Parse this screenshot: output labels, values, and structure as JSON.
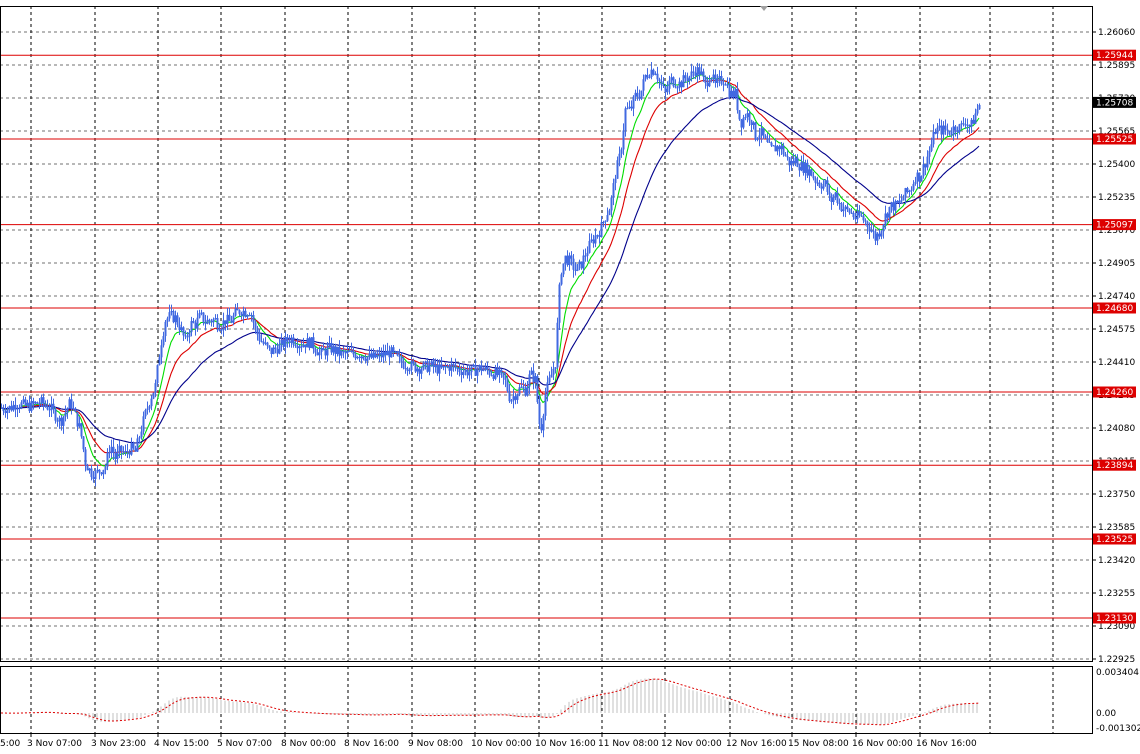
{
  "chart_data": {
    "type": "candlestick",
    "instrument_hint": "",
    "price_axis": {
      "range": [
        1.22925,
        1.2612
      ],
      "ticks": [
        "1.26060",
        "1.25895",
        "1.25730",
        "1.25565",
        "1.25400",
        "1.25235",
        "1.25070",
        "1.24905",
        "1.24740",
        "1.24575",
        "1.24410",
        "1.24245",
        "1.24080",
        "1.23915",
        "1.23750",
        "1.23585",
        "1.23420",
        "1.23255",
        "1.23090",
        "1.22925"
      ]
    },
    "time_axis": {
      "labels": [
        "3 Nov 07:00",
        "3 Nov 23:00",
        "4 Nov 15:00",
        "5 Nov 07:00",
        "8 Nov 00:00",
        "8 Nov 16:00",
        "9 Nov 08:00",
        "10 Nov 00:00",
        "10 Nov 16:00",
        "11 Nov 08:00",
        "12 Nov 00:00",
        "12 Nov 16:00",
        "15 Nov 08:00",
        "16 Nov 00:00",
        "16 Nov 16:00"
      ],
      "left_partial_label": "5:00"
    },
    "current_price": "1.25708",
    "levels": [
      {
        "label": "1.25944",
        "value": 1.25944
      },
      {
        "label": "1.25525",
        "value": 1.25525
      },
      {
        "label": "1.25097",
        "value": 1.25097
      },
      {
        "label": "1.24680",
        "value": 1.2468
      },
      {
        "label": "1.24260",
        "value": 1.2426
      },
      {
        "label": "1.23894",
        "value": 1.23894
      },
      {
        "label": "1.23525",
        "value": 1.23525
      },
      {
        "label": "1.23130",
        "value": 1.2313
      }
    ],
    "price_path": {
      "x": [
        0,
        5,
        10,
        15,
        20,
        25,
        30,
        40,
        50,
        60,
        65,
        70,
        75,
        80,
        85,
        90,
        95,
        100,
        105,
        110,
        115,
        120,
        125,
        130,
        135,
        140,
        145,
        150,
        155,
        160,
        165,
        170,
        175,
        180,
        185,
        190,
        195,
        200,
        205,
        210,
        215,
        220,
        225,
        230,
        235,
        240,
        245,
        250,
        255,
        260,
        270,
        280,
        290,
        300,
        310,
        320,
        330,
        340,
        350,
        360,
        370,
        380,
        390,
        400,
        410,
        420,
        430,
        440,
        450,
        460,
        470,
        480,
        490,
        500,
        505,
        510,
        515,
        520,
        525,
        530,
        535,
        540,
        545,
        550,
        555,
        560,
        565,
        570,
        575,
        580,
        585,
        590,
        595,
        600,
        605,
        610,
        615,
        620,
        625,
        630,
        635,
        640,
        645,
        650,
        655,
        660,
        665,
        670,
        675,
        680,
        685,
        690,
        695,
        700,
        705,
        710,
        715,
        720,
        725,
        730,
        735,
        740,
        745,
        750,
        755,
        760,
        765,
        770,
        775,
        780,
        785,
        790,
        795,
        800,
        805,
        810,
        815,
        820,
        825,
        830,
        835,
        840,
        845,
        850,
        855,
        860,
        865,
        870,
        875,
        880,
        885,
        890,
        895,
        900,
        905,
        910,
        915,
        920,
        925,
        930,
        935,
        940,
        945,
        950,
        955,
        960,
        965,
        970,
        975,
        980
      ],
      "y": [
        1.2418,
        1.2418,
        1.2418,
        1.242,
        1.242,
        1.2419,
        1.2419,
        1.2421,
        1.2418,
        1.2411,
        1.2416,
        1.2421,
        1.2414,
        1.2407,
        1.2391,
        1.2386,
        1.2385,
        1.2387,
        1.2389,
        1.24,
        1.2393,
        1.2397,
        1.2395,
        1.2398,
        1.2396,
        1.2406,
        1.2415,
        1.2423,
        1.2429,
        1.2449,
        1.2462,
        1.2464,
        1.2463,
        1.2458,
        1.2451,
        1.246,
        1.246,
        1.2464,
        1.2461,
        1.2462,
        1.2462,
        1.2459,
        1.2462,
        1.2461,
        1.2465,
        1.2467,
        1.2466,
        1.2467,
        1.2457,
        1.2452,
        1.2446,
        1.2449,
        1.2453,
        1.245,
        1.2451,
        1.2445,
        1.2448,
        1.2445,
        1.2445,
        1.2445,
        1.2443,
        1.2444,
        1.2446,
        1.2441,
        1.2439,
        1.2438,
        1.2439,
        1.2437,
        1.2439,
        1.2437,
        1.2436,
        1.2438,
        1.2436,
        1.2434,
        1.2431,
        1.2422,
        1.2425,
        1.2428,
        1.2427,
        1.2435,
        1.2432,
        1.2405,
        1.2425,
        1.2433,
        1.2441,
        1.2486,
        1.2493,
        1.2491,
        1.2487,
        1.2489,
        1.2495,
        1.25,
        1.2504,
        1.2507,
        1.2514,
        1.2519,
        1.2535,
        1.2545,
        1.2567,
        1.2567,
        1.2574,
        1.2575,
        1.2584,
        1.2587,
        1.2587,
        1.258,
        1.2575,
        1.2582,
        1.2581,
        1.258,
        1.2583,
        1.2584,
        1.2587,
        1.2586,
        1.2579,
        1.2586,
        1.2579,
        1.2582,
        1.2582,
        1.2575,
        1.2575,
        1.256,
        1.2565,
        1.2564,
        1.2554,
        1.2556,
        1.2551,
        1.2547,
        1.2548,
        1.2549,
        1.2544,
        1.254,
        1.2542,
        1.2539,
        1.2538,
        1.2536,
        1.2532,
        1.253,
        1.253,
        1.2521,
        1.2525,
        1.2519,
        1.2517,
        1.2516,
        1.2513,
        1.2514,
        1.2511,
        1.2508,
        1.2503,
        1.2507,
        1.2514,
        1.2519,
        1.2519,
        1.2521,
        1.2525,
        1.2527,
        1.2534,
        1.2534,
        1.2541,
        1.2548,
        1.2557,
        1.2557,
        1.2557,
        1.2556,
        1.2559,
        1.2558,
        1.2562,
        1.2558,
        1.2565,
        1.2571
      ]
    },
    "moving_averages": [
      {
        "color": "#00dd00",
        "period": 0
      },
      {
        "color": "#dd0000",
        "period": 0
      },
      {
        "color": "#00008b",
        "period": 0
      }
    ],
    "oscillator": {
      "range": [
        -0.001302,
        0.003404
      ],
      "ticks": [
        "0.003404",
        "0.00",
        "-0.001302"
      ],
      "histogram_color": "#c0c0c0",
      "signal_color": "#dd0000"
    },
    "grid": true,
    "colors": {
      "background": "#ffffff",
      "candle": "#4169e1",
      "level_line": "#dd0000",
      "grid": "#000000",
      "current_price_box": "#000000"
    }
  }
}
